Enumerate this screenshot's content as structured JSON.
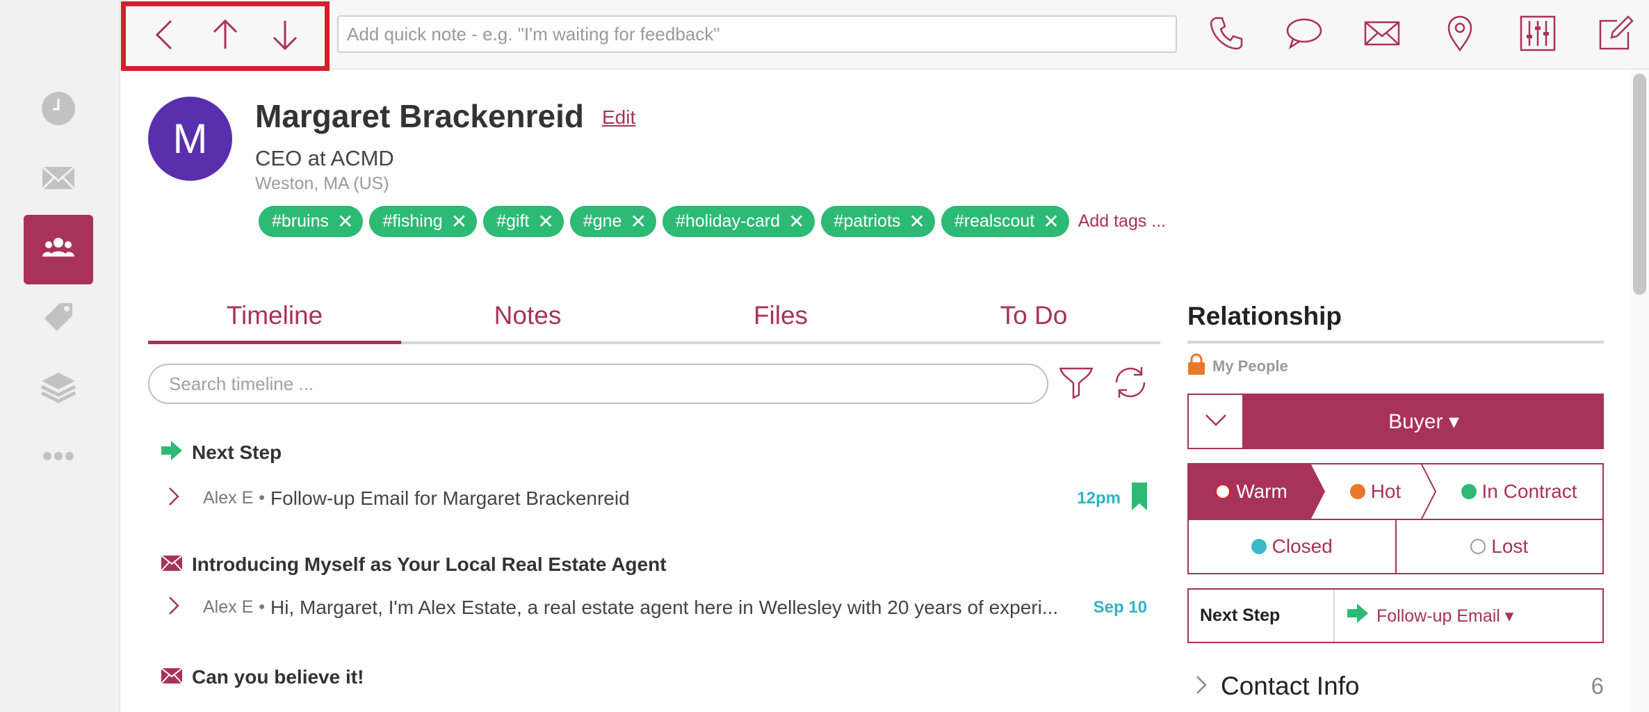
{
  "colors": {
    "brand": "#a8325a",
    "tag_green": "#2dba74",
    "date_blue": "#2fb3c5",
    "avatar_purple": "#5a2fae"
  },
  "rail": {
    "items": [
      {
        "icon": "clock-icon",
        "active": false
      },
      {
        "icon": "mail-icon",
        "active": false
      },
      {
        "icon": "people-icon",
        "active": true
      },
      {
        "icon": "tag-icon",
        "active": false
      },
      {
        "icon": "layers-icon",
        "active": false
      },
      {
        "icon": "more-icon",
        "active": false
      }
    ]
  },
  "toolbar": {
    "nav": [
      "back-icon",
      "up-arrow-icon",
      "down-arrow-icon"
    ],
    "quick_note_placeholder": "Add quick note - e.g. \"I'm waiting for feedback\"",
    "tools": [
      "phone-icon",
      "chat-icon",
      "email-icon",
      "location-icon",
      "sliders-icon",
      "compose-icon"
    ]
  },
  "profile": {
    "initial": "M",
    "name": "Margaret Brackenreid",
    "edit_label": "Edit",
    "job": "CEO at ACMD",
    "location": "Weston, MA (US)",
    "tags": [
      "#bruins",
      "#fishing",
      "#gift",
      "#gne",
      "#holiday-card",
      "#patriots",
      "#realscout"
    ],
    "add_tags_label": "Add tags ..."
  },
  "tabs": [
    {
      "label": "Timeline",
      "active": true
    },
    {
      "label": "Notes",
      "active": false
    },
    {
      "label": "Files",
      "active": false
    },
    {
      "label": "To Do",
      "active": false
    }
  ],
  "timeline": {
    "search_placeholder": "Search timeline ...",
    "entries": [
      {
        "icon": "arrow-right-icon",
        "title": "Next Step",
        "author": "Alex E",
        "text": "Follow-up Email for Margaret Brackenreid",
        "when": "12pm",
        "bookmark": true
      },
      {
        "icon": "envelope-icon",
        "title": "Introducing Myself as Your Local Real Estate Agent",
        "author": "Alex E",
        "text": "Hi, Margaret, I'm Alex Estate, a real estate agent here in Wellesley with 20 years of experi...",
        "when": "Sep 10"
      },
      {
        "icon": "envelope-icon",
        "title": "Can you believe it!"
      }
    ]
  },
  "relationship": {
    "title": "Relationship",
    "group": "My People",
    "type": "Buyer ▾",
    "stages": [
      {
        "label": "Warm",
        "color": "#d0212a",
        "active": true,
        "filled": false
      },
      {
        "label": "Hot",
        "color": "#e8782a",
        "active": false,
        "filled": true
      },
      {
        "label": "In Contract",
        "color": "#2dba74",
        "active": false,
        "filled": true
      },
      {
        "label": "Closed",
        "color": "#3bb8c9",
        "active": false,
        "filled": true
      },
      {
        "label": "Lost",
        "color": "#9a9a9a",
        "active": false,
        "filled": false
      }
    ],
    "next_step_label": "Next Step",
    "next_step_value": "Follow-up Email ▾"
  },
  "contact_info": {
    "label": "Contact Info",
    "count": "6"
  }
}
